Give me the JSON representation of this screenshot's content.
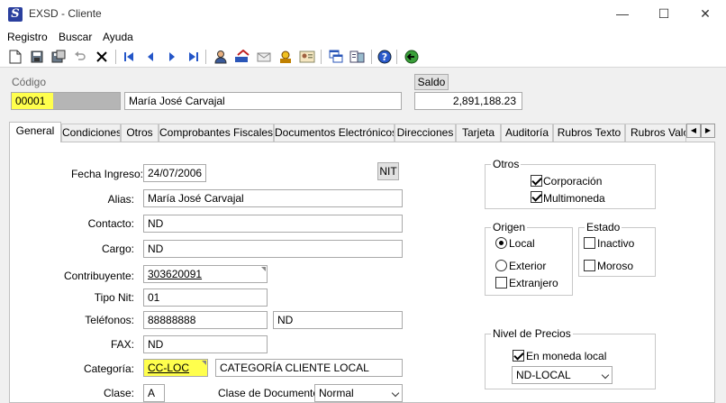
{
  "window": {
    "title": "EXSD - Cliente",
    "app_icon_letter": "S",
    "minimize": "—",
    "maximize": "☐",
    "close": "✕"
  },
  "menu": [
    "Registro",
    "Buscar",
    "Ayuda"
  ],
  "header": {
    "codigo_label": "Código",
    "codigo_value": "00001",
    "nombre_value": "María José Carvajal",
    "saldo_label": "Saldo",
    "saldo_value": "2,891,188.23"
  },
  "tabs": [
    "General",
    "Condiciones",
    "Otros",
    "Comprobantes Fiscales",
    "Documentos Electrónicos",
    "Direcciones",
    "Tarjeta",
    "Auditoría",
    "Rubros Texto",
    "Rubros Valor"
  ],
  "form": {
    "fecha_ingreso_label": "Fecha Ingreso:",
    "fecha_ingreso_value": "24/07/2006",
    "nit_button": "NIT",
    "alias_label": "Alias:",
    "alias_value": "María José Carvajal",
    "contacto_label": "Contacto:",
    "contacto_value": "ND",
    "cargo_label": "Cargo:",
    "cargo_value": "ND",
    "contribuyente_label": "Contribuyente:",
    "contribuyente_value": "303620091",
    "tipo_nit_label": "Tipo Nit:",
    "tipo_nit_value": "01",
    "telefonos_label": "Teléfonos:",
    "telefono1_value": "88888888",
    "telefono2_value": "ND",
    "fax_label": "FAX:",
    "fax_value": "ND",
    "categoria_label": "Categoría:",
    "categoria_code": "CC-LOC",
    "categoria_desc": "CATEGORÍA CLIENTE LOCAL",
    "clase_label": "Clase:",
    "clase_value": "A",
    "clase_documento_label": "Clase de Documento:",
    "clase_documento_value": "Normal"
  },
  "otros": {
    "title": "Otros",
    "corporacion": "Corporación",
    "multimoneda": "Multimoneda"
  },
  "origen": {
    "title": "Origen",
    "local": "Local",
    "exterior": "Exterior",
    "extranjero": "Extranjero"
  },
  "estado": {
    "title": "Estado",
    "inactivo": "Inactivo",
    "moroso": "Moroso"
  },
  "nivel_precios": {
    "title": "Nivel de Precios",
    "en_moneda_local": "En moneda local",
    "nivel_value": "ND-LOCAL"
  },
  "tab_scroll": {
    "left": "◀",
    "right": "▶"
  }
}
